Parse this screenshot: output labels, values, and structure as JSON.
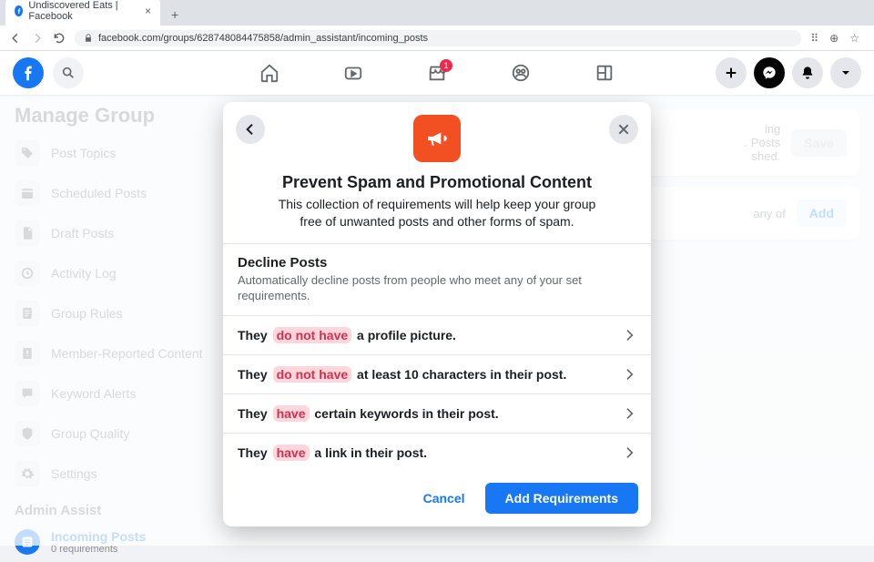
{
  "browser": {
    "tab_title": "Undiscovered Eats | Facebook",
    "url": "facebook.com/groups/628748084475858/admin_assistant/incoming_posts"
  },
  "header": {
    "marketplace_badge": "1"
  },
  "sidebar": {
    "title": "Manage Group",
    "items": [
      {
        "label": "Post Topics"
      },
      {
        "label": "Scheduled Posts"
      },
      {
        "label": "Draft Posts"
      },
      {
        "label": "Activity Log"
      },
      {
        "label": "Group Rules"
      },
      {
        "label": "Member-Reported Content"
      },
      {
        "label": "Keyword Alerts"
      },
      {
        "label": "Group Quality"
      },
      {
        "label": "Settings"
      }
    ],
    "section_label": "Admin Assist",
    "incoming": {
      "label": "Incoming Posts",
      "sub": "0 requirements"
    }
  },
  "content": {
    "card1_text_a": "ing",
    "card1_text_b": ". Posts",
    "card1_text_c": "shed.",
    "save_label": "Save",
    "card2_text": "any of",
    "add_label": "Add"
  },
  "dialog": {
    "title": "Prevent Spam and Promotional Content",
    "subtitle": "This collection of requirements will help keep your group free of unwanted posts and other forms of spam.",
    "section_title": "Decline Posts",
    "section_desc": "Automatically decline posts from people who meet any of your set requirements.",
    "rules": [
      {
        "prefix": "They ",
        "pill": "do not have",
        "suffix": " a profile picture."
      },
      {
        "prefix": "They ",
        "pill": "do not have",
        "suffix": " at least 10 characters in their post."
      },
      {
        "prefix": "They ",
        "pill": "have",
        "suffix": " certain keywords in their post."
      },
      {
        "prefix": "They ",
        "pill": "have",
        "suffix": " a link in their post."
      }
    ],
    "cancel_label": "Cancel",
    "primary_label": "Add Requirements"
  }
}
